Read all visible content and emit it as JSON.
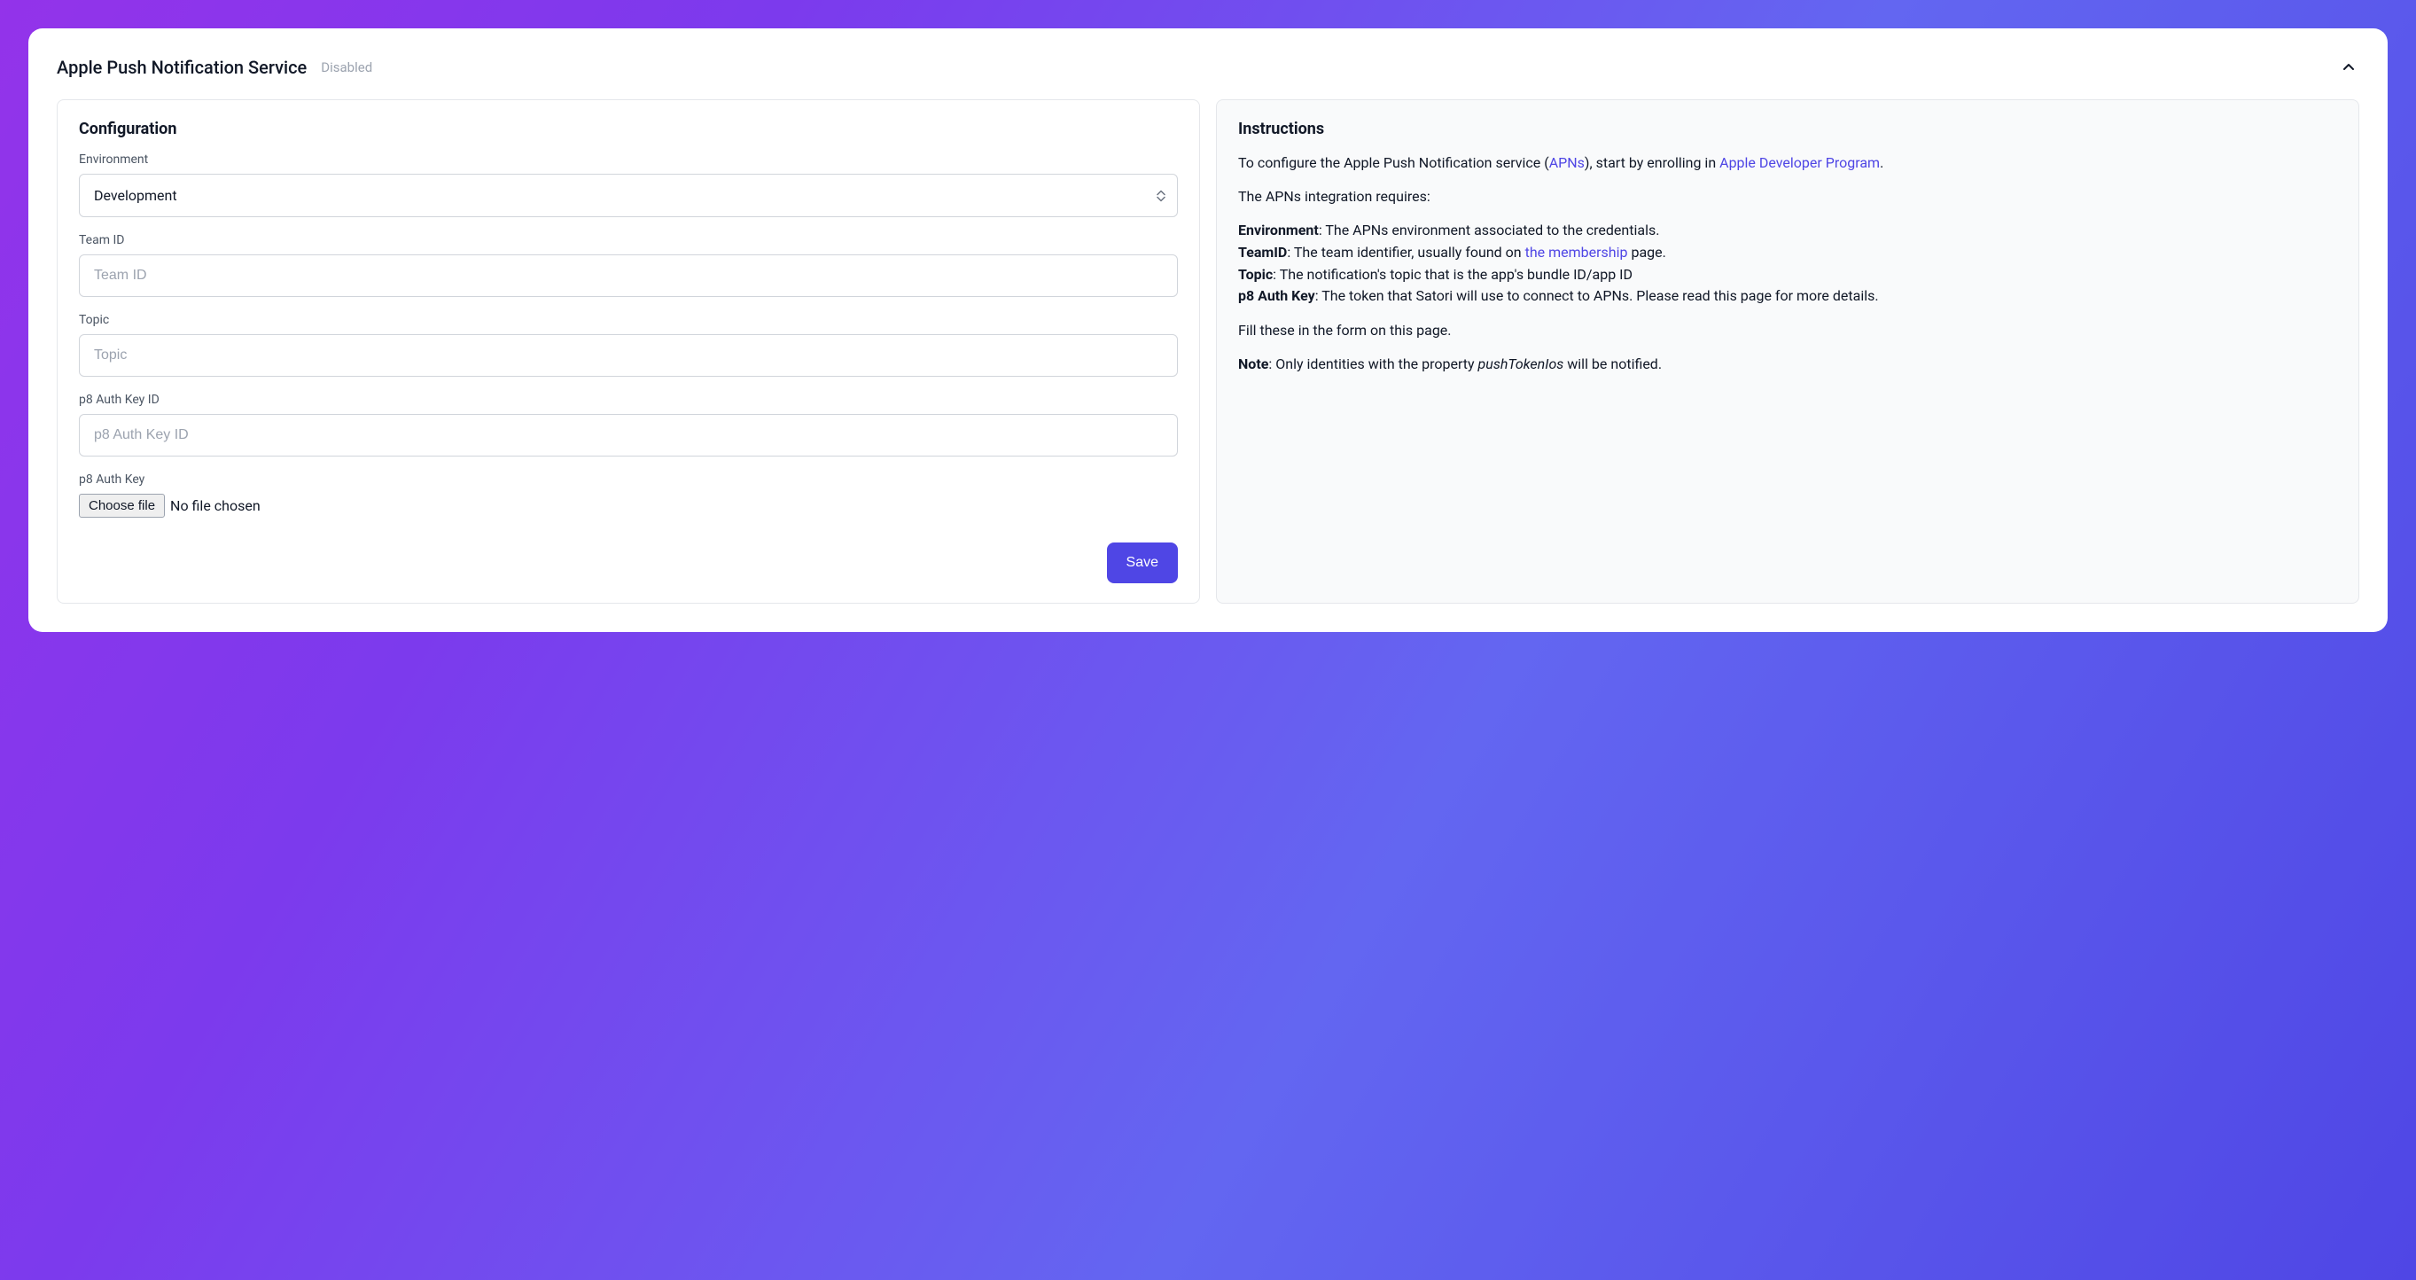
{
  "header": {
    "title": "Apple Push Notification Service",
    "status": "Disabled"
  },
  "config": {
    "heading": "Configuration",
    "environment": {
      "label": "Environment",
      "value": "Development"
    },
    "team_id": {
      "label": "Team ID",
      "placeholder": "Team ID"
    },
    "topic": {
      "label": "Topic",
      "placeholder": "Topic"
    },
    "p8_auth_key_id": {
      "label": "p8 Auth Key ID",
      "placeholder": "p8 Auth Key ID"
    },
    "p8_auth_key": {
      "label": "p8 Auth Key",
      "button": "Choose file",
      "status": "No file chosen"
    },
    "save_button": "Save"
  },
  "instructions": {
    "heading": "Instructions",
    "intro_prefix": "To configure the Apple Push Notification service (",
    "apns_link": "APNs",
    "intro_mid": "), start by enrolling in ",
    "dev_program_link": "Apple Developer Program",
    "intro_suffix": ".",
    "requires_line": "The APNs integration requires:",
    "defs": {
      "environment": {
        "label": "Environment",
        "text": ": The APNs environment associated to the credentials."
      },
      "teamid": {
        "label": "TeamID",
        "text_prefix": ": The team identifier, usually found on ",
        "link": "the membership",
        "text_suffix": " page."
      },
      "topic": {
        "label": "Topic",
        "text": ": The notification's topic that is the app's bundle ID/app ID"
      },
      "p8": {
        "label": "p8 Auth Key",
        "text": ": The token that Satori will use to connect to APNs. Please read this page for more details."
      }
    },
    "fill_line": "Fill these in the form on this page.",
    "note": {
      "label": "Note",
      "prefix": ": Only identities with the property ",
      "italic": "pushTokenIos",
      "suffix": " will be notified."
    }
  }
}
